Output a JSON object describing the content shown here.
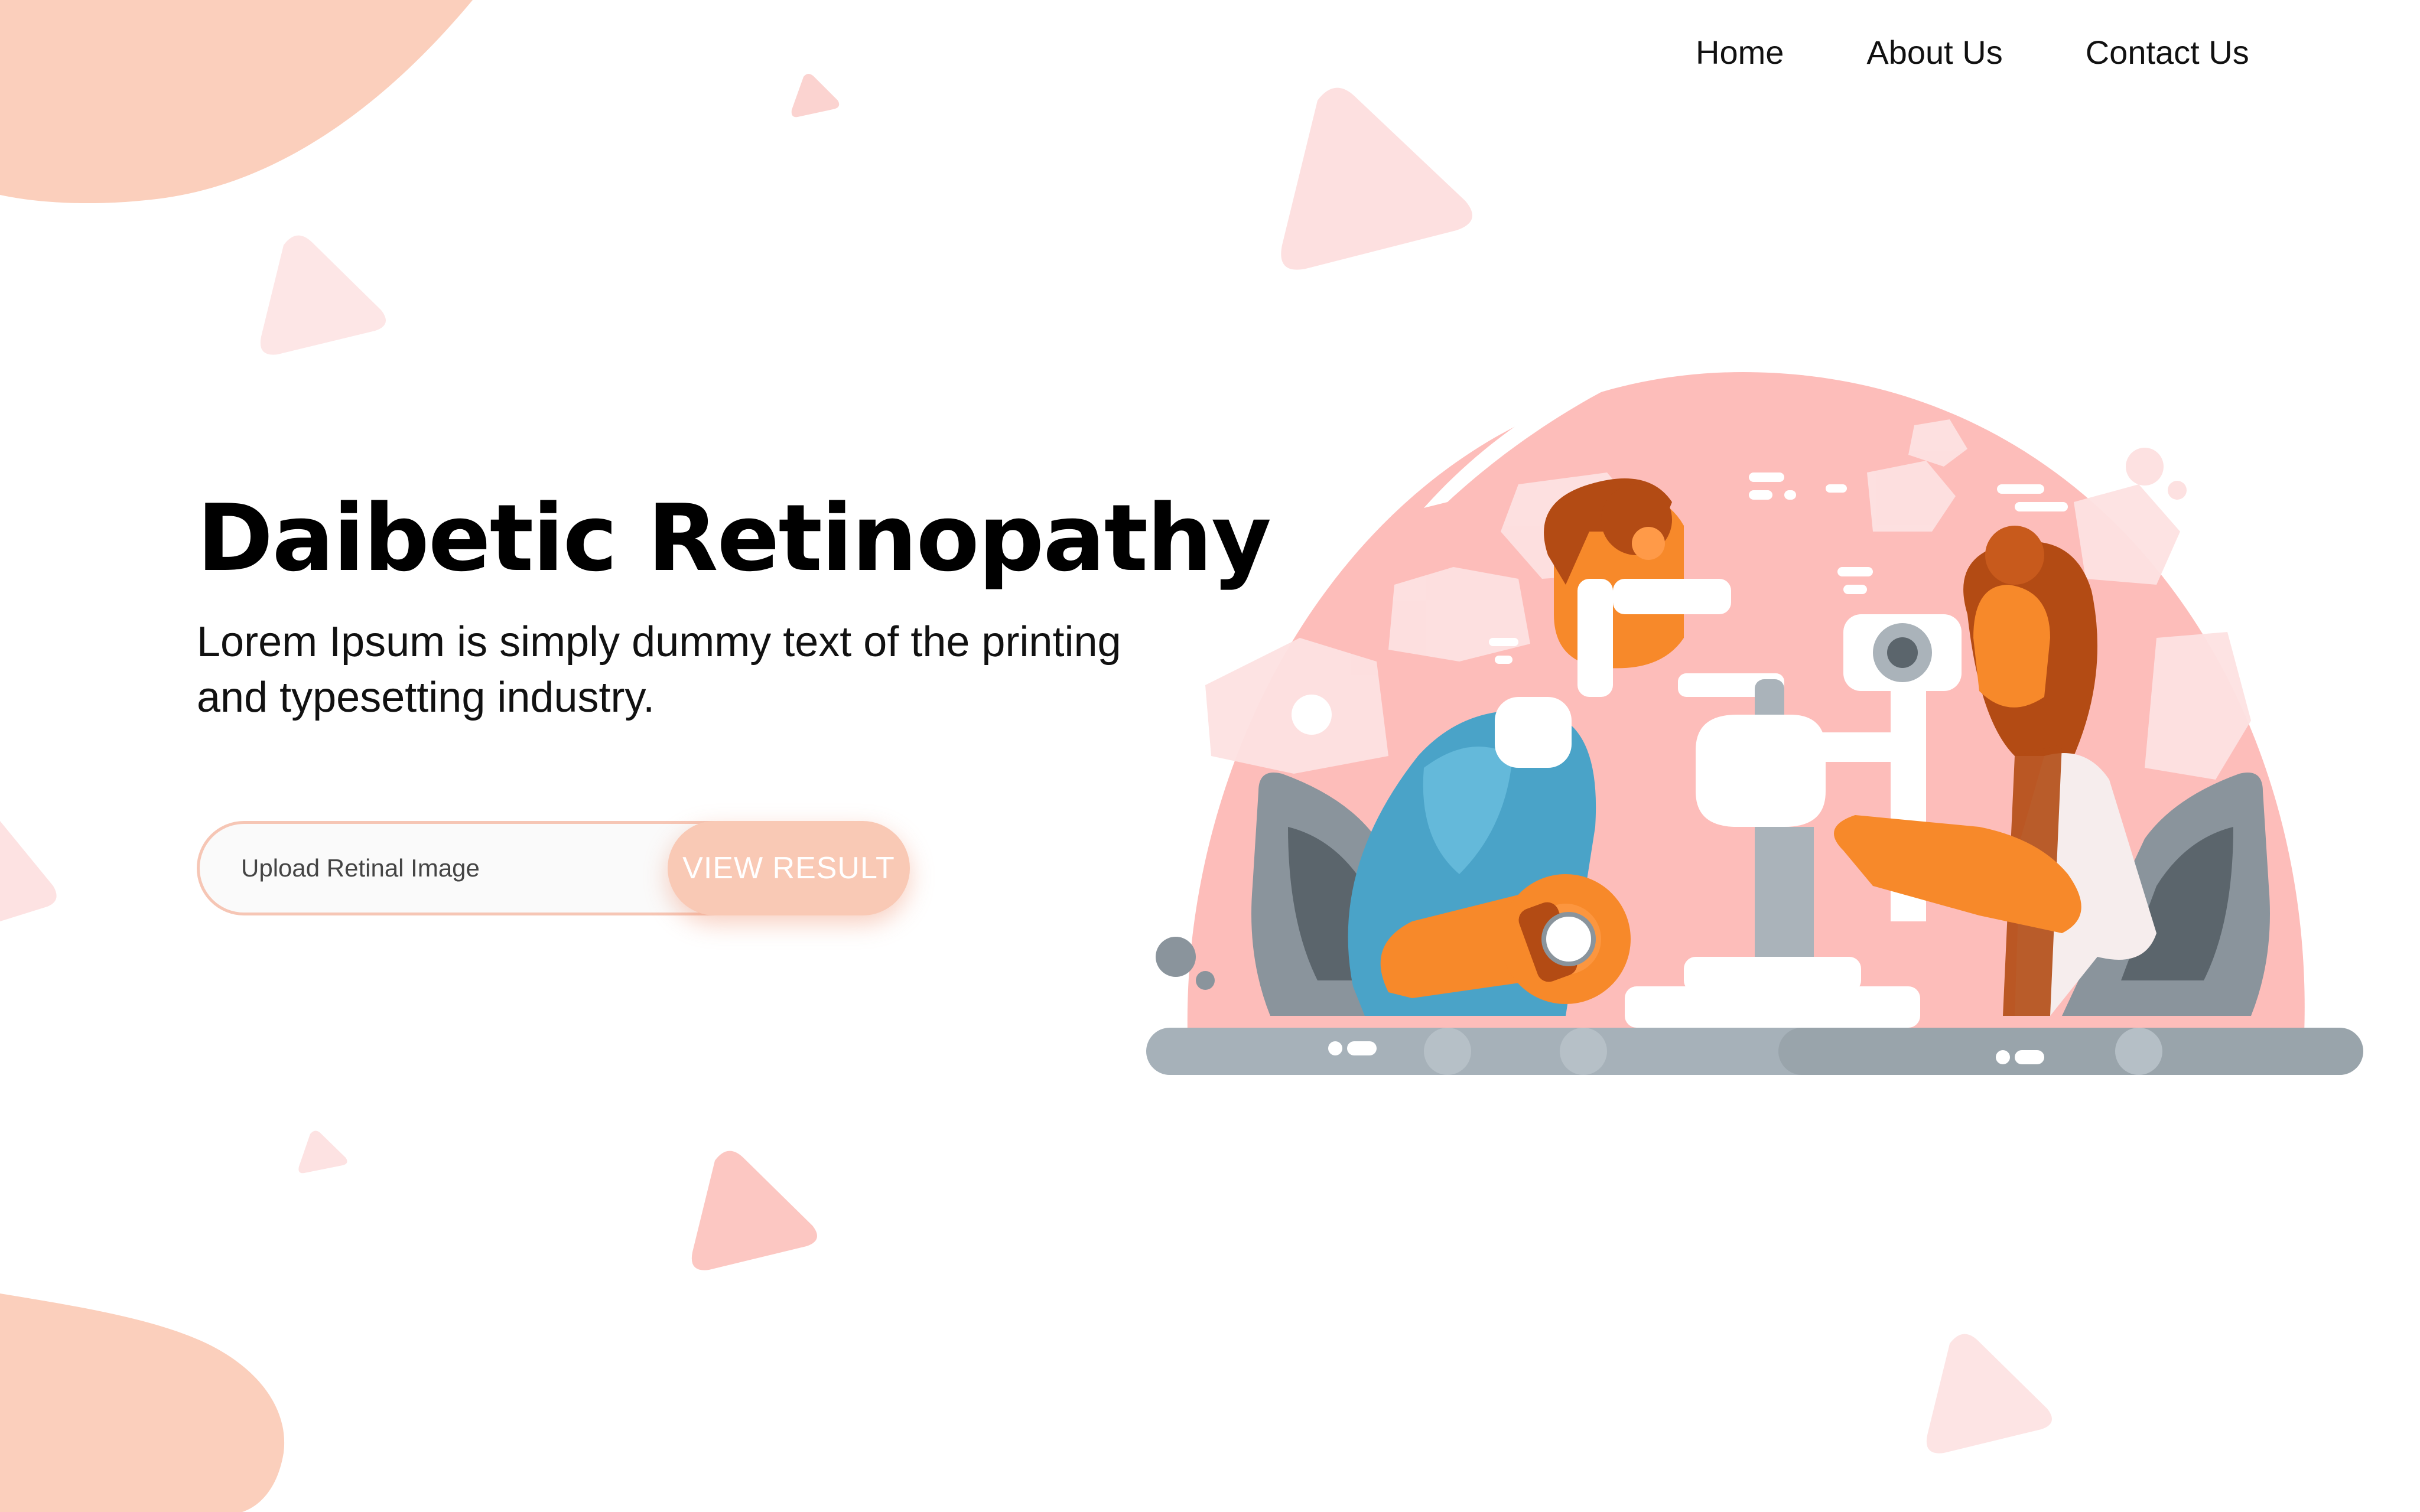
{
  "nav": {
    "home": "Home",
    "about": "About Us",
    "contact": "Contact Us"
  },
  "hero": {
    "title": "Daibetic Retinopathy",
    "description": "Lorem Ipsum is simply dummy text of the printing and typesetting industry."
  },
  "upload": {
    "label": "Upload Retinal Image",
    "button": "VIEW RESULT"
  },
  "colors": {
    "blob": "#fbcfbc",
    "accent": "#f9c9b5",
    "pink_circle": "#fdbdba",
    "orange": "#f7892a",
    "blue": "#4aa3c8",
    "grey": "#8a949c"
  }
}
